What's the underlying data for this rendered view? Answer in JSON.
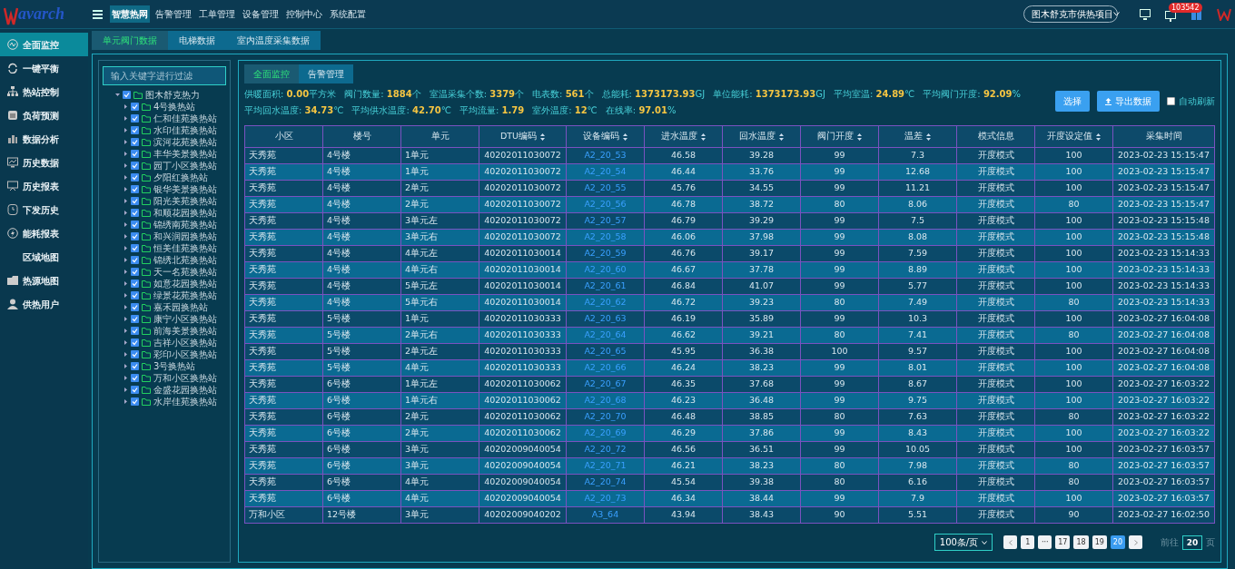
{
  "top_bar": {
    "logo": "avarch",
    "nav": [
      {
        "label": "智慧热网",
        "selected": true
      },
      {
        "label": "告警管理",
        "selected": false
      },
      {
        "label": "工单管理",
        "selected": false
      },
      {
        "label": "设备管理",
        "selected": false
      },
      {
        "label": "控制中心",
        "selected": false
      },
      {
        "label": "系统配置",
        "selected": false
      }
    ],
    "project_select": {
      "value": "图木舒克市供热项目"
    },
    "alert_badge": "103542"
  },
  "sidebar": {
    "items": [
      {
        "label": "全面监控",
        "selected": true
      },
      {
        "label": "一键平衡",
        "selected": false
      },
      {
        "label": "热站控制",
        "selected": false
      },
      {
        "label": "负荷预测",
        "selected": false
      },
      {
        "label": "数据分析",
        "selected": false
      },
      {
        "label": "历史数据",
        "selected": false
      },
      {
        "label": "历史报表",
        "selected": false
      },
      {
        "label": "下发历史",
        "selected": false
      },
      {
        "label": "能耗报表",
        "selected": false
      },
      {
        "label": "区域地图",
        "selected": false
      },
      {
        "label": "热源地图",
        "selected": false
      },
      {
        "label": "供热用户",
        "selected": false
      }
    ]
  },
  "page_tabs": [
    {
      "label": "单元阀门数据",
      "selected": true
    },
    {
      "label": "电梯数据",
      "selected": false
    },
    {
      "label": "室内温度采集数据",
      "selected": false
    }
  ],
  "tree": {
    "filter": {
      "placeholder": "输入关键字进行过滤"
    },
    "root": {
      "label": "图木舒克热力",
      "checked": true,
      "expanded": true,
      "children": [
        {
          "label": "4号换热站",
          "checked": true,
          "expanded": false
        },
        {
          "label": "仁和佳苑换热站",
          "checked": true,
          "expanded": false
        },
        {
          "label": "水印佳苑换热站",
          "checked": true,
          "expanded": false
        },
        {
          "label": "滨河花苑换热站",
          "checked": true,
          "expanded": false
        },
        {
          "label": "丰华美景换热站",
          "checked": true,
          "expanded": false
        },
        {
          "label": "园丁小区换热站",
          "checked": true,
          "expanded": false
        },
        {
          "label": "夕阳红换热站",
          "checked": true,
          "expanded": false
        },
        {
          "label": "银华美景换热站",
          "checked": true,
          "expanded": false
        },
        {
          "label": "阳光美苑换热站",
          "checked": true,
          "expanded": false
        },
        {
          "label": "和顺花园换热站",
          "checked": true,
          "expanded": false
        },
        {
          "label": "锦绣南苑换热站",
          "checked": true,
          "expanded": false
        },
        {
          "label": "和兴润园换热站",
          "checked": true,
          "expanded": false
        },
        {
          "label": "恒美佳苑换热站",
          "checked": true,
          "expanded": false
        },
        {
          "label": "锦绣北苑换热站",
          "checked": true,
          "expanded": false
        },
        {
          "label": "天一名苑换热站",
          "checked": true,
          "expanded": false
        },
        {
          "label": "如意花园换热站",
          "checked": true,
          "expanded": false
        },
        {
          "label": "绿景花苑换热站",
          "checked": true,
          "expanded": false
        },
        {
          "label": "嘉禾园换热站",
          "checked": true,
          "expanded": false
        },
        {
          "label": "康宁小区换热站",
          "checked": true,
          "expanded": false
        },
        {
          "label": "前海美景换热站",
          "checked": true,
          "expanded": false
        },
        {
          "label": "吉祥小区换热站",
          "checked": true,
          "expanded": false
        },
        {
          "label": "彩印小区换热站",
          "checked": true,
          "expanded": false
        },
        {
          "label": "3号换热站",
          "checked": true,
          "expanded": false
        },
        {
          "label": "万和小区换热站",
          "checked": true,
          "expanded": false
        },
        {
          "label": "金盛花园换热站",
          "checked": true,
          "expanded": false
        },
        {
          "label": "水岸佳苑换热站",
          "checked": true,
          "expanded": false
        }
      ]
    }
  },
  "panel_tabs": [
    {
      "label": "全面监控",
      "selected": true
    },
    {
      "label": "告警管理",
      "selected": false
    }
  ],
  "stats": [
    {
      "label": "供暖面积:",
      "value": "0.00",
      "unit": "平方米"
    },
    {
      "label": "阀门数量:",
      "value": "1884",
      "unit": "个"
    },
    {
      "label": "室温采集个数:",
      "value": "3379",
      "unit": "个"
    },
    {
      "label": "电表数:",
      "value": "561",
      "unit": "个"
    },
    {
      "label": "总能耗:",
      "value": "1373173.93",
      "unit": "GJ"
    },
    {
      "label": "单位能耗:",
      "value": "1373173.93",
      "unit": "GJ"
    },
    {
      "label": "平均室温:",
      "value": "24.89",
      "unit": "℃"
    },
    {
      "label": "平均阀门开度:",
      "value": "92.09",
      "unit": "%"
    },
    {
      "label": "平均回水温度:",
      "value": "34.73",
      "unit": "℃"
    },
    {
      "label": "平均供水温度:",
      "value": "42.70",
      "unit": "℃"
    },
    {
      "label": "平均流量:",
      "value": "1.79"
    },
    {
      "label": "室外温度:",
      "value": "12",
      "unit": "℃"
    },
    {
      "label": "在线率:",
      "value": "97.01",
      "unit": "%"
    }
  ],
  "actions": [
    {
      "label": "选择",
      "kind": "plain"
    },
    {
      "label": "导出数据",
      "kind": "export"
    }
  ],
  "auto_refresh": {
    "label": "自动刷新",
    "checked": false
  },
  "table": {
    "columns": [
      {
        "label": "小区",
        "sortable": false
      },
      {
        "label": "楼号",
        "sortable": false
      },
      {
        "label": "单元",
        "sortable": false
      },
      {
        "label": "DTU编码",
        "sortable": true
      },
      {
        "label": "设备编码",
        "sortable": true
      },
      {
        "label": "进水温度",
        "sortable": true
      },
      {
        "label": "回水温度",
        "sortable": true
      },
      {
        "label": "阀门开度",
        "sortable": true
      },
      {
        "label": "温差",
        "sortable": true
      },
      {
        "label": "模式信息",
        "sortable": false
      },
      {
        "label": "开度设定值",
        "sortable": true
      },
      {
        "label": "采集时间",
        "sortable": false
      }
    ],
    "rows": [
      [
        "天秀苑",
        "4号楼",
        "1单元",
        "40202011030072",
        "A2_20_53",
        "46.58",
        "39.28",
        "99",
        "7.3",
        "开度模式",
        "100",
        "2023-02-23 15:15:47"
      ],
      [
        "天秀苑",
        "4号楼",
        "1单元",
        "40202011030072",
        "A2_20_54",
        "46.44",
        "33.76",
        "99",
        "12.68",
        "开度模式",
        "100",
        "2023-02-23 15:15:47"
      ],
      [
        "天秀苑",
        "4号楼",
        "2单元",
        "40202011030072",
        "A2_20_55",
        "45.76",
        "34.55",
        "99",
        "11.21",
        "开度模式",
        "100",
        "2023-02-23 15:15:47"
      ],
      [
        "天秀苑",
        "4号楼",
        "2单元",
        "40202011030072",
        "A2_20_56",
        "46.78",
        "38.72",
        "80",
        "8.06",
        "开度模式",
        "80",
        "2023-02-23 15:15:47"
      ],
      [
        "天秀苑",
        "4号楼",
        "3单元左",
        "40202011030072",
        "A2_20_57",
        "46.79",
        "39.29",
        "99",
        "7.5",
        "开度模式",
        "100",
        "2023-02-23 15:15:48"
      ],
      [
        "天秀苑",
        "4号楼",
        "3单元右",
        "40202011030072",
        "A2_20_58",
        "46.06",
        "37.98",
        "99",
        "8.08",
        "开度模式",
        "100",
        "2023-02-23 15:15:48"
      ],
      [
        "天秀苑",
        "4号楼",
        "4单元左",
        "40202011030014",
        "A2_20_59",
        "46.76",
        "39.17",
        "99",
        "7.59",
        "开度模式",
        "100",
        "2023-02-23 15:14:33"
      ],
      [
        "天秀苑",
        "4号楼",
        "4单元右",
        "40202011030014",
        "A2_20_60",
        "46.67",
        "37.78",
        "99",
        "8.89",
        "开度模式",
        "100",
        "2023-02-23 15:14:33"
      ],
      [
        "天秀苑",
        "4号楼",
        "5单元左",
        "40202011030014",
        "A2_20_61",
        "46.84",
        "41.07",
        "99",
        "5.77",
        "开度模式",
        "100",
        "2023-02-23 15:14:33"
      ],
      [
        "天秀苑",
        "4号楼",
        "5单元右",
        "40202011030014",
        "A2_20_62",
        "46.72",
        "39.23",
        "80",
        "7.49",
        "开度模式",
        "80",
        "2023-02-23 15:14:33"
      ],
      [
        "天秀苑",
        "5号楼",
        "1单元",
        "40202011030333",
        "A2_20_63",
        "46.19",
        "35.89",
        "99",
        "10.3",
        "开度模式",
        "100",
        "2023-02-27 16:04:08"
      ],
      [
        "天秀苑",
        "5号楼",
        "2单元右",
        "40202011030333",
        "A2_20_64",
        "46.62",
        "39.21",
        "80",
        "7.41",
        "开度模式",
        "80",
        "2023-02-27 16:04:08"
      ],
      [
        "天秀苑",
        "5号楼",
        "2单元左",
        "40202011030333",
        "A2_20_65",
        "45.95",
        "36.38",
        "100",
        "9.57",
        "开度模式",
        "100",
        "2023-02-27 16:04:08"
      ],
      [
        "天秀苑",
        "5号楼",
        "4单元",
        "40202011030333",
        "A2_20_66",
        "46.24",
        "38.23",
        "99",
        "8.01",
        "开度模式",
        "100",
        "2023-02-27 16:04:08"
      ],
      [
        "天秀苑",
        "6号楼",
        "1单元左",
        "40202011030062",
        "A2_20_67",
        "46.35",
        "37.68",
        "99",
        "8.67",
        "开度模式",
        "100",
        "2023-02-27 16:03:22"
      ],
      [
        "天秀苑",
        "6号楼",
        "1单元右",
        "40202011030062",
        "A2_20_68",
        "46.23",
        "36.48",
        "99",
        "9.75",
        "开度模式",
        "100",
        "2023-02-27 16:03:22"
      ],
      [
        "天秀苑",
        "6号楼",
        "2单元",
        "40202011030062",
        "A2_20_70",
        "46.48",
        "38.85",
        "80",
        "7.63",
        "开度模式",
        "80",
        "2023-02-27 16:03:22"
      ],
      [
        "天秀苑",
        "6号楼",
        "2单元",
        "40202011030062",
        "A2_20_69",
        "46.29",
        "37.86",
        "99",
        "8.43",
        "开度模式",
        "100",
        "2023-02-27 16:03:22"
      ],
      [
        "天秀苑",
        "6号楼",
        "3单元",
        "40202009040054",
        "A2_20_72",
        "46.56",
        "36.51",
        "99",
        "10.05",
        "开度模式",
        "100",
        "2023-02-27 16:03:57"
      ],
      [
        "天秀苑",
        "6号楼",
        "3单元",
        "40202009040054",
        "A2_20_71",
        "46.21",
        "38.23",
        "80",
        "7.98",
        "开度模式",
        "80",
        "2023-02-27 16:03:57"
      ],
      [
        "天秀苑",
        "6号楼",
        "4单元",
        "40202009040054",
        "A2_20_74",
        "45.54",
        "39.38",
        "80",
        "6.16",
        "开度模式",
        "80",
        "2023-02-27 16:03:57"
      ],
      [
        "天秀苑",
        "6号楼",
        "4单元",
        "40202009040054",
        "A2_20_73",
        "46.34",
        "38.44",
        "99",
        "7.9",
        "开度模式",
        "100",
        "2023-02-27 16:03:57"
      ],
      [
        "万和小区",
        "12号楼",
        "3单元",
        "40202009040202",
        "A3_64",
        "43.94",
        "38.43",
        "90",
        "5.51",
        "开度模式",
        "90",
        "2023-02-27 16:02:50"
      ]
    ]
  },
  "pagination": {
    "page_size": "100条/页",
    "pages": [
      {
        "label": "1",
        "selected": false
      },
      {
        "label": "···",
        "selected": false
      },
      {
        "label": "17",
        "selected": false
      },
      {
        "label": "18",
        "selected": false
      },
      {
        "label": "19",
        "selected": false
      },
      {
        "label": "20",
        "selected": true
      }
    ],
    "goto_label": "前往",
    "goto_value": "20",
    "page_unit": "页"
  }
}
